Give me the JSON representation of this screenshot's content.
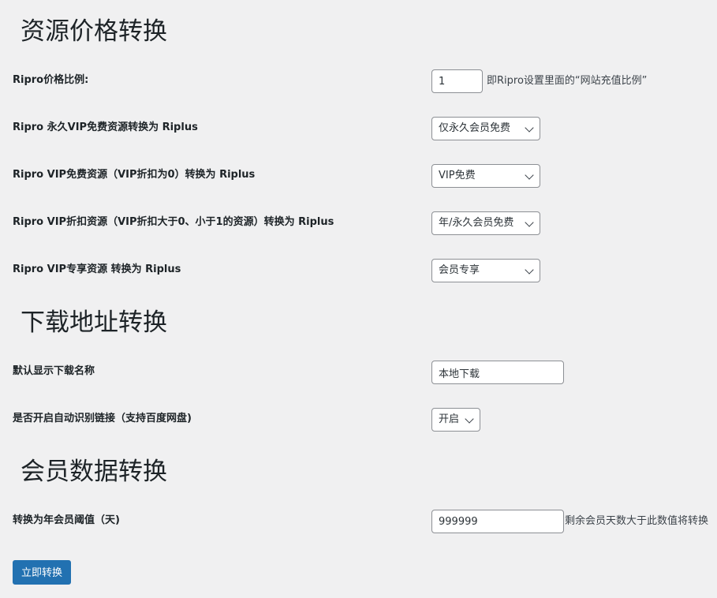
{
  "sections": {
    "price": {
      "title": "资源价格转换"
    },
    "download": {
      "title": "下载地址转换"
    },
    "member": {
      "title": "会员数据转换"
    }
  },
  "price": {
    "ratio": {
      "label": "Ripro价格比例:",
      "value": "1",
      "description": "即Ripro设置里面的“网站充值比例”"
    },
    "permanent_vip_free": {
      "label": "Ripro 永久VIP免费资源转换为 Riplus",
      "selected": "仅永久会员免费"
    },
    "vip_free": {
      "label": "Ripro VIP免费资源（VIP折扣为0）转换为 Riplus",
      "selected": "VIP免费"
    },
    "vip_discount": {
      "label": "Ripro VIP折扣资源（VIP折扣大于0、小于1的资源）转换为 Riplus",
      "selected": "年/永久会员免费"
    },
    "vip_exclusive": {
      "label": "Ripro VIP专享资源 转换为 Riplus",
      "selected": "会员专享"
    }
  },
  "download": {
    "default_name": {
      "label": "默认显示下载名称",
      "value": "本地下载"
    },
    "auto_detect": {
      "label": "是否开启自动识别链接（支持百度网盘)",
      "selected": "开启"
    }
  },
  "member": {
    "threshold": {
      "label": "转换为年会员阈值（天)",
      "value": "999999",
      "description": "剩余会员天数大于此数值将转换"
    }
  },
  "actions": {
    "convert_label": "立即转换"
  },
  "colors": {
    "background": "#f0f0f1",
    "primary_button": "#2271b1"
  }
}
